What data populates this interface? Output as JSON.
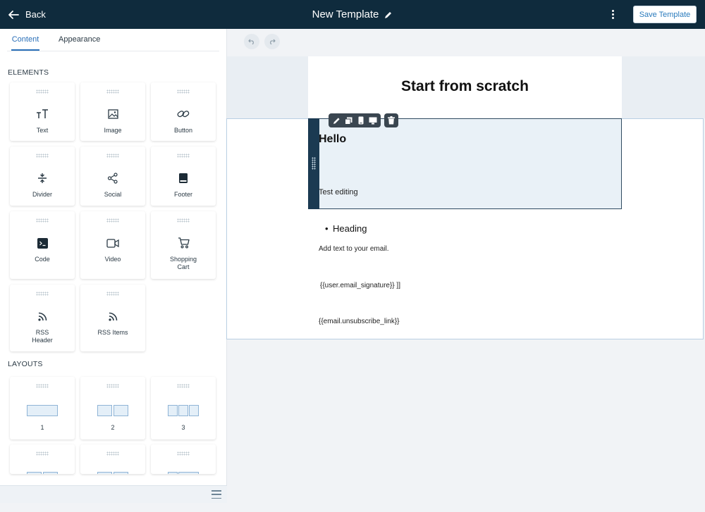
{
  "header": {
    "back_label": "Back",
    "title": "New Template",
    "save_label": "Save Template"
  },
  "sidebar": {
    "tabs": [
      {
        "label": "Content",
        "active": true
      },
      {
        "label": "Appearance",
        "active": false
      }
    ],
    "elements_title": "ELEMENTS",
    "elements": [
      {
        "label": "Text",
        "icon": "text-icon"
      },
      {
        "label": "Image",
        "icon": "image-icon"
      },
      {
        "label": "Button",
        "icon": "link-icon"
      },
      {
        "label": "Divider",
        "icon": "divider-icon"
      },
      {
        "label": "Social",
        "icon": "share-icon"
      },
      {
        "label": "Footer",
        "icon": "footer-icon"
      },
      {
        "label": "Code",
        "icon": "terminal-icon"
      },
      {
        "label": "Video",
        "icon": "video-icon"
      },
      {
        "label": "Shopping\nCart",
        "icon": "cart-icon"
      },
      {
        "label": "RSS\nHeader",
        "icon": "rss-icon"
      },
      {
        "label": "RSS Items",
        "icon": "rss-icon"
      }
    ],
    "layouts_title": "LAYOUTS",
    "layouts": [
      {
        "label": "1"
      },
      {
        "label": "2"
      },
      {
        "label": "3"
      }
    ]
  },
  "canvas": {
    "heading": "Start from scratch",
    "selected_title": "Hello",
    "selected_body": "Test editing",
    "bullet": "Heading",
    "add_text": "Add text to your email.",
    "signature": "{{user.email_signature}} ]]",
    "unsubscribe": "{{email.unsubscribe_link}}"
  },
  "colors": {
    "topbar": "#0f2b3d",
    "accent": "#2a6fb8",
    "selection": "#1b3a52"
  }
}
